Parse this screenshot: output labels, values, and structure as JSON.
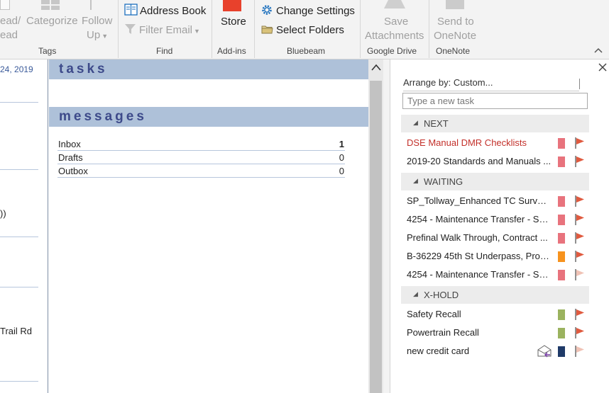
{
  "ribbon": {
    "tags": {
      "read_line1": "ead/",
      "read_line2": "ead",
      "categorize": "Categorize",
      "follow_line1": "Follow",
      "follow_line2": "Up",
      "label": "Tags"
    },
    "find": {
      "address_book": "Address Book",
      "filter_email": "Filter Email",
      "label": "Find"
    },
    "addins": {
      "store": "Store",
      "label": "Add-ins"
    },
    "bluebeam": {
      "change_settings": "Change Settings",
      "select_folders": "Select Folders",
      "label": "Bluebeam"
    },
    "google_drive": {
      "save_line1": "Save",
      "save_line2": "Attachments",
      "label": "Google Drive"
    },
    "onenote": {
      "send_line1": "Send to",
      "send_line2": "OneNote",
      "label": "OneNote"
    },
    "collapse_icon": "chevron-up-icon"
  },
  "left_column": {
    "date_fragment": "24, 2019",
    "text1": "))",
    "text2": "Trail Rd"
  },
  "outlook_today": {
    "tasks_heading": "tasks",
    "messages_heading": "messages",
    "folders": [
      {
        "name": "Inbox",
        "count": "1",
        "bold": true
      },
      {
        "name": "Drafts",
        "count": "0",
        "bold": false
      },
      {
        "name": "Outbox",
        "count": "0",
        "bold": false
      }
    ]
  },
  "task_pane": {
    "arrange_by": "Arrange by: Custom...",
    "new_task_placeholder": "Type a new task",
    "groups": [
      {
        "name": "NEXT",
        "tasks": [
          {
            "title": "DSE Manual DMR Checklists",
            "color": "#e8737d",
            "flag": "red",
            "highlight": true
          },
          {
            "title": "2019-20 Standards and Manuals ...",
            "color": "#e8737d",
            "flag": "red",
            "highlight": false
          }
        ]
      },
      {
        "name": "WAITING",
        "tasks": [
          {
            "title": "SP_Tollway_Enhanced TC Surveilla...",
            "color": "#e8737d",
            "flag": "red",
            "highlight": false
          },
          {
            "title": "4254 - Maintenance Transfer - So...",
            "color": "#e8737d",
            "flag": "red",
            "highlight": false
          },
          {
            "title": "Prefinal Walk Through, Contract ...",
            "color": "#e8737d",
            "flag": "red",
            "highlight": false
          },
          {
            "title": "B-36229 45th St Underpass, Prog...",
            "color": "#f7931e",
            "flag": "red",
            "highlight": false
          },
          {
            "title": "4254 - Maintenance Transfer - So...",
            "color": "#e8737d",
            "flag": "pale",
            "highlight": false
          }
        ]
      },
      {
        "name": "X-HOLD",
        "tasks": [
          {
            "title": "Safety Recall",
            "color": "#9bb35f",
            "flag": "red",
            "highlight": false
          },
          {
            "title": "Powertrain Recall",
            "color": "#9bb35f",
            "flag": "red",
            "highlight": false
          },
          {
            "title": "new credit card",
            "color": "#1f3a68",
            "flag": "pale",
            "highlight": false,
            "mail_icon": true
          }
        ]
      }
    ]
  },
  "colors": {
    "flag_red": "#e05a3f",
    "flag_pale": "#f0c2b5",
    "section_blue": "#aec1d9",
    "heading_text": "#3d4a8a",
    "office_red": "#e8412c",
    "bluebeam_blue": "#1c6fbd"
  }
}
